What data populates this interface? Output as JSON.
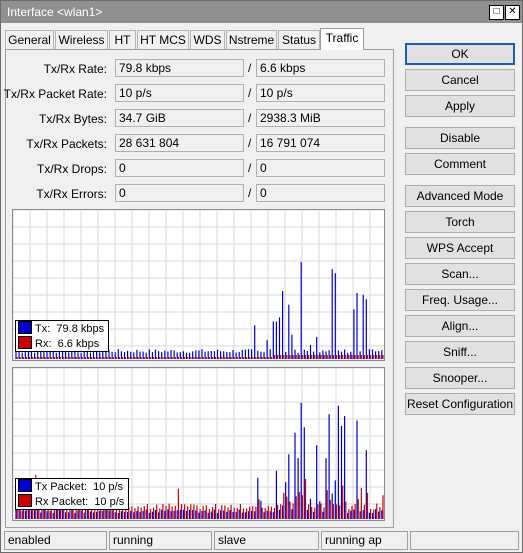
{
  "window": {
    "title": "Interface <wlan1>",
    "restore_glyph": "□",
    "close_glyph": "✕"
  },
  "tabs": [
    {
      "label": "General"
    },
    {
      "label": "Wireless"
    },
    {
      "label": "HT"
    },
    {
      "label": "HT MCS"
    },
    {
      "label": "WDS"
    },
    {
      "label": "Nstreme"
    },
    {
      "label": "Status"
    },
    {
      "label": "Traffic",
      "active": true
    }
  ],
  "stats": {
    "separator": "/",
    "rows": [
      {
        "label": "Tx/Rx Rate:",
        "tx": "79.8 kbps",
        "rx": "6.6 kbps"
      },
      {
        "label": "Tx/Rx Packet Rate:",
        "tx": "10 p/s",
        "rx": "10 p/s"
      },
      {
        "label": "Tx/Rx Bytes:",
        "tx": "34.7 GiB",
        "rx": "2938.3 MiB"
      },
      {
        "label": "Tx/Rx Packets:",
        "tx": "28 631 804",
        "rx": "16 791 074"
      },
      {
        "label": "Tx/Rx Drops:",
        "tx": "0",
        "rx": "0"
      },
      {
        "label": "Tx/Rx Errors:",
        "tx": "0",
        "rx": "0"
      }
    ]
  },
  "colors": {
    "tx": "#0000cc",
    "rx": "#cc0000",
    "grid": "#d8d8e0"
  },
  "traffic_legend": [
    {
      "name": "Tx:",
      "value": "79.8 kbps",
      "color": "#0000cc"
    },
    {
      "name": "Rx:",
      "value": "6.6 kbps",
      "color": "#cc0000"
    }
  ],
  "packet_legend": [
    {
      "name": "Tx Packet:",
      "value": "10 p/s",
      "color": "#0000cc"
    },
    {
      "name": "Rx Packet:",
      "value": "10 p/s",
      "color": "#cc0000"
    }
  ],
  "buttons": {
    "ok": "OK",
    "cancel": "Cancel",
    "apply": "Apply",
    "disable": "Disable",
    "comment": "Comment",
    "advanced_mode": "Advanced Mode",
    "torch": "Torch",
    "wps_accept": "WPS Accept",
    "scan": "Scan...",
    "freq_usage": "Freq. Usage...",
    "align": "Align...",
    "sniff": "Sniff...",
    "snooper": "Snooper...",
    "reset_configuration": "Reset Configuration"
  },
  "status_bar": [
    "enabled",
    "running",
    "slave",
    "running ap",
    ""
  ]
}
